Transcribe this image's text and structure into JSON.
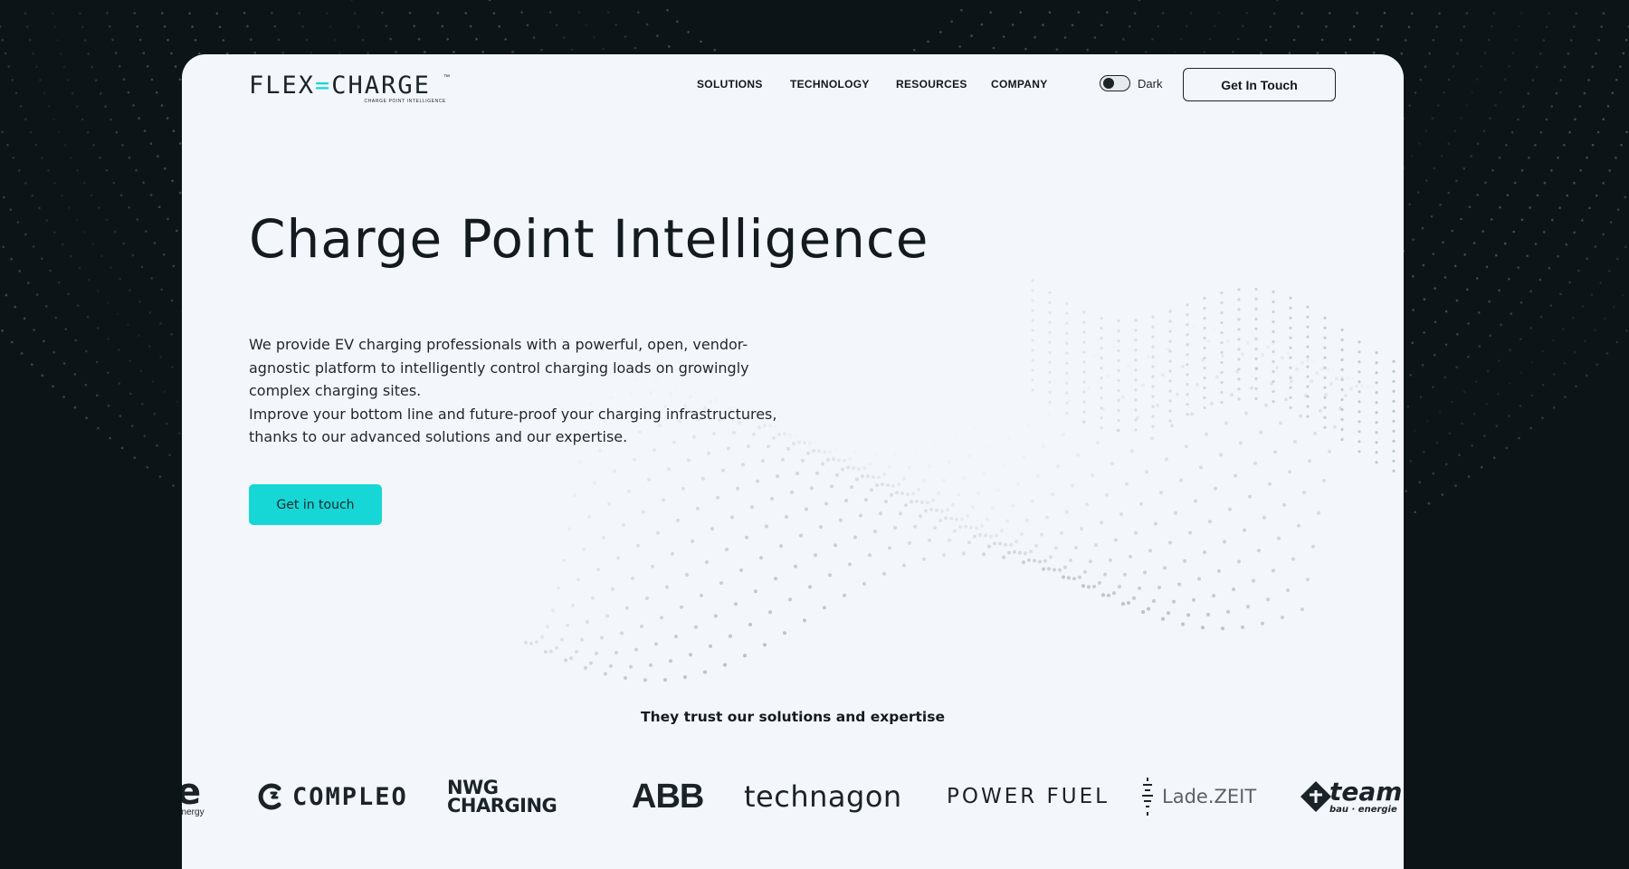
{
  "brand": {
    "logo_left": "FLEX",
    "logo_mark": "=",
    "logo_right": "CHARGE",
    "logo_tm": "™",
    "tagline": "CHARGE POINT INTELLIGENCE"
  },
  "nav": {
    "items": [
      {
        "label": "SOLUTIONS"
      },
      {
        "label": "TECHNOLOGY"
      },
      {
        "label": "RESOURCES"
      },
      {
        "label": "COMPANY"
      }
    ],
    "theme_toggle_label": "Dark",
    "cta_label": "Get In Touch"
  },
  "hero": {
    "title": "Charge Point Intelligence",
    "paragraph_1": "We provide EV charging professionals with a powerful, open, vendor-agnostic platform to intelligently control charging loads on growingly complex charging sites.",
    "paragraph_2": "Improve your bottom line and future-proof your charging infrastructures, thanks to our advanced solutions and our expertise.",
    "cta_label": "Get in touch"
  },
  "trust": {
    "heading": "They trust our solutions and expertise",
    "logos": [
      {
        "name": "e energy",
        "text": "e",
        "sub": "energy"
      },
      {
        "name": "compleo",
        "text": "COMPLEO"
      },
      {
        "name": "nwg-charging",
        "line1": "NWG",
        "line2": "CHARGING"
      },
      {
        "name": "abb",
        "text": "ABB"
      },
      {
        "name": "technagon",
        "text": "technagon"
      },
      {
        "name": "power-fuel",
        "text": "POWER FUEL"
      },
      {
        "name": "lade-zeit",
        "text": "Lade.ZEIT"
      },
      {
        "name": "team",
        "text": "team",
        "sub": "bau · energie"
      }
    ]
  },
  "colors": {
    "accent": "#17d6d6",
    "background_dark": "#0c1418",
    "card_background": "#f3f7fb",
    "text_dark": "#141b20"
  }
}
